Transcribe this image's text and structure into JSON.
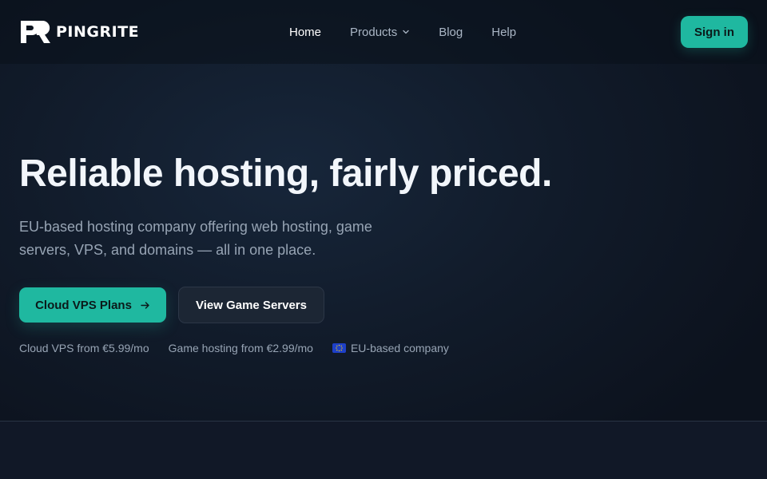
{
  "brand": {
    "name": "PINGRITE",
    "logo_icon": "pingrite-logo-icon"
  },
  "nav": {
    "items": [
      {
        "label": "Home",
        "active": true
      },
      {
        "label": "Products",
        "has_dropdown": true,
        "icon": "chevron-down-icon"
      },
      {
        "label": "Blog"
      },
      {
        "label": "Help"
      }
    ],
    "signin_label": "Sign in"
  },
  "hero": {
    "title": "Reliable hosting, fairly priced.",
    "subtitle": "EU-based hosting company offering web hosting, game servers, VPS, and domains — all in one place.",
    "primary_cta": {
      "label": "Cloud VPS Plans",
      "icon": "arrow-right-icon"
    },
    "secondary_cta": {
      "label": "View Game Servers"
    },
    "facts": [
      {
        "text": "Cloud VPS from €5.99/mo"
      },
      {
        "text": "Game hosting from €2.99/mo"
      },
      {
        "text": "EU-based company",
        "icon": "eu-flag-icon"
      }
    ]
  },
  "colors": {
    "accent": "#1fb8a0",
    "background": "#0d1420",
    "text_primary": "#f2f6fb",
    "text_muted": "#97a4b4"
  }
}
